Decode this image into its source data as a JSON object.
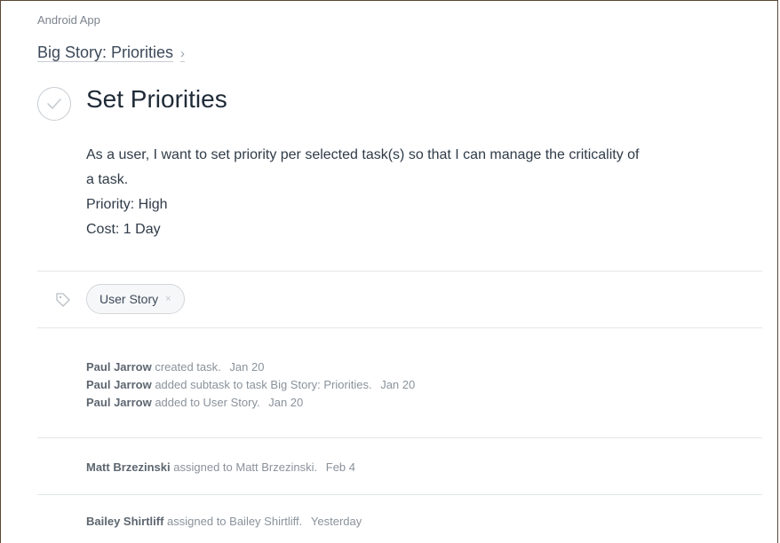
{
  "header": {
    "project": "Android App",
    "parent_task": "Big Story: Priorities",
    "parent_chevron": "›"
  },
  "task": {
    "title": "Set Priorities",
    "completed": false,
    "complete_icon": "checkmark-circle-icon",
    "description_lines": [
      "As a user, I want to set priority per selected task(s) so that I can manage the criticality of",
      "a task.",
      "Priority: High",
      "Cost: 1 Day"
    ]
  },
  "tags": {
    "icon": "tag-icon",
    "items": [
      {
        "label": "User Story",
        "remove": "×"
      }
    ]
  },
  "activity": {
    "groups": [
      [
        {
          "actor": "Paul Jarrow",
          "action": "created task.",
          "date": "Jan 20"
        },
        {
          "actor": "Paul Jarrow",
          "action": "added subtask to task Big Story: Priorities.",
          "date": "Jan 20"
        },
        {
          "actor": "Paul Jarrow",
          "action": "added to User Story.",
          "date": "Jan 20"
        }
      ],
      [
        {
          "actor": "Matt Brzezinski",
          "action": "assigned to Matt Brzezinski.",
          "date": "Feb 4"
        }
      ],
      [
        {
          "actor": "Bailey Shirtliff",
          "action": "assigned to Bailey Shirtliff.",
          "date": "Yesterday"
        }
      ]
    ]
  },
  "colors": {
    "title": "#1f2a37",
    "muted": "#8a929b",
    "divider": "#e3e6e9",
    "frame_border": "#5a4636"
  }
}
